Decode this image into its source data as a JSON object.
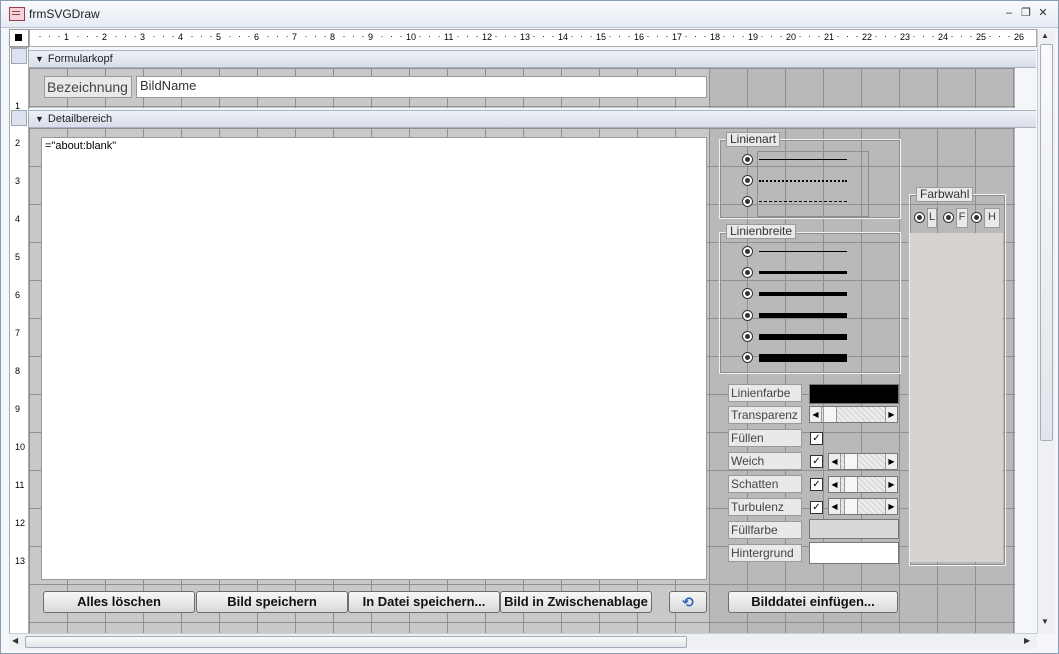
{
  "window": {
    "title": "frmSVGDraw",
    "controls": [
      "minimize-icon",
      "restore-icon",
      "close-icon"
    ]
  },
  "ruler": {
    "h_labels": [
      "1",
      "2",
      "3",
      "4",
      "5",
      "6",
      "7",
      "8",
      "9",
      "10",
      "11",
      "12",
      "13",
      "14",
      "15",
      "16",
      "17",
      "18",
      "19",
      "20",
      "21",
      "22",
      "23",
      "24",
      "25",
      "26"
    ],
    "v_labels": [
      "1",
      "2",
      "3",
      "4",
      "5",
      "6",
      "7",
      "8",
      "9",
      "10",
      "11",
      "12",
      "13"
    ]
  },
  "sections": {
    "header": "Formularkopf",
    "detail": "Detailbereich"
  },
  "header_fields": {
    "label": "Bezeichnung",
    "textbox_value": "BildName"
  },
  "web_control": {
    "source": "=\"about:blank\""
  },
  "buttons": {
    "clear_all": "Alles löschen",
    "save_image": "Bild speichern",
    "save_file": "In Datei speichern...",
    "clipboard": "Bild in Zwischenablage",
    "insert_file": "Bilddatei einfügen..."
  },
  "groups": {
    "line_style": "Linienart",
    "line_width": "Linienbreite",
    "color_choice": "Farbwahl",
    "color_options": [
      "L",
      "F",
      "H"
    ]
  },
  "properties": {
    "line_color": "Linienfarbe",
    "transparency": "Transparenz",
    "fill": "Füllen",
    "soft": "Weich",
    "shadow": "Schatten",
    "turbulence": "Turbulenz",
    "fill_color": "Füllfarbe",
    "background": "Hintergrund"
  },
  "colors": {
    "line_color": "#000000",
    "fill_color": "#d8d8d8",
    "background": "#ffffff"
  }
}
